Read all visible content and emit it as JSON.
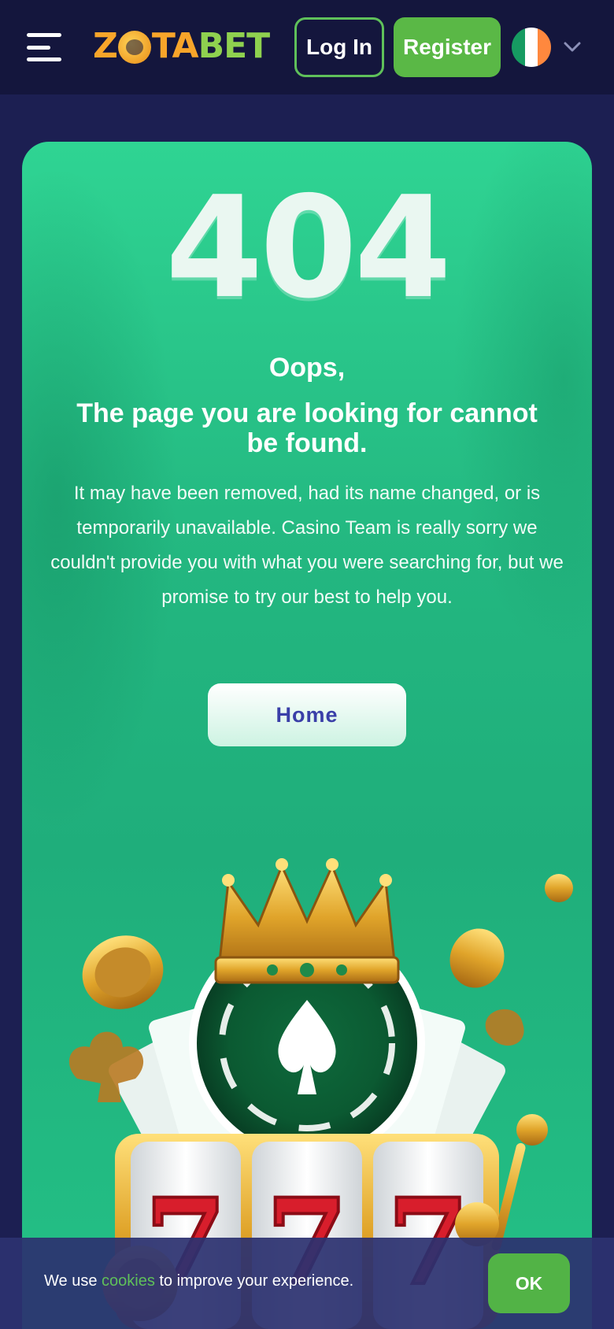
{
  "header": {
    "logo_left": "Z",
    "logo_mid": "TA",
    "logo_right": "BET",
    "login_label": "Log In",
    "register_label": "Register",
    "language_flag": "ireland-flag-icon",
    "flag_colors": [
      "#169b62",
      "#ffffff",
      "#ff883e"
    ]
  },
  "main": {
    "error_code": "404",
    "oops": "Oops,",
    "headline": "The page you are looking for cannot be found.",
    "description": "It may have been removed, had its name changed, or is temporarily unavailable. Casino Team is really sorry we couldn't provide you with what you were searching for, but we promise to try our best to help you.",
    "home_label": "Home"
  },
  "cookie_bar": {
    "text_before": "We use ",
    "link": "cookies",
    "text_after": " to improve your experience.",
    "ok_label": "OK"
  },
  "colors": {
    "header_bg": "#14163d",
    "page_bg": "#1c1f52",
    "accent_green": "#5ab846",
    "card_green": "#23b780",
    "home_text": "#3a3fa8"
  },
  "illustration": {
    "slot_symbols": [
      "7",
      "7",
      "7"
    ]
  }
}
